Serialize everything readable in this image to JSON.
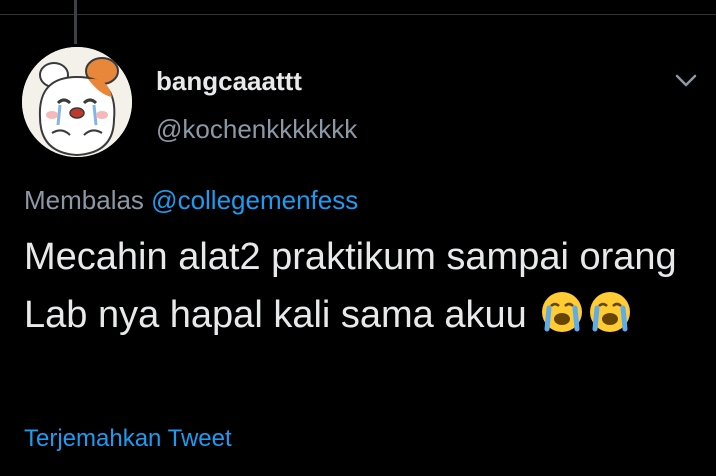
{
  "tweet": {
    "display_name": "bangcaaattt",
    "handle": "@kochenkkkkkkk",
    "reply_prefix": "Membalas",
    "reply_to": "@collegemenfess",
    "text": "Mecahin alat2 praktikum sampai orang Lab nya hapal kali sama akuu",
    "emojis": [
      "loudly-crying-face-icon",
      "loudly-crying-face-icon"
    ],
    "translate_label": "Terjemahkan Tweet"
  },
  "colors": {
    "background": "#000000",
    "text_primary": "#e7e9ea",
    "text_secondary": "#8b98a5",
    "link": "#1d9bf0",
    "divider": "#2f3336"
  }
}
